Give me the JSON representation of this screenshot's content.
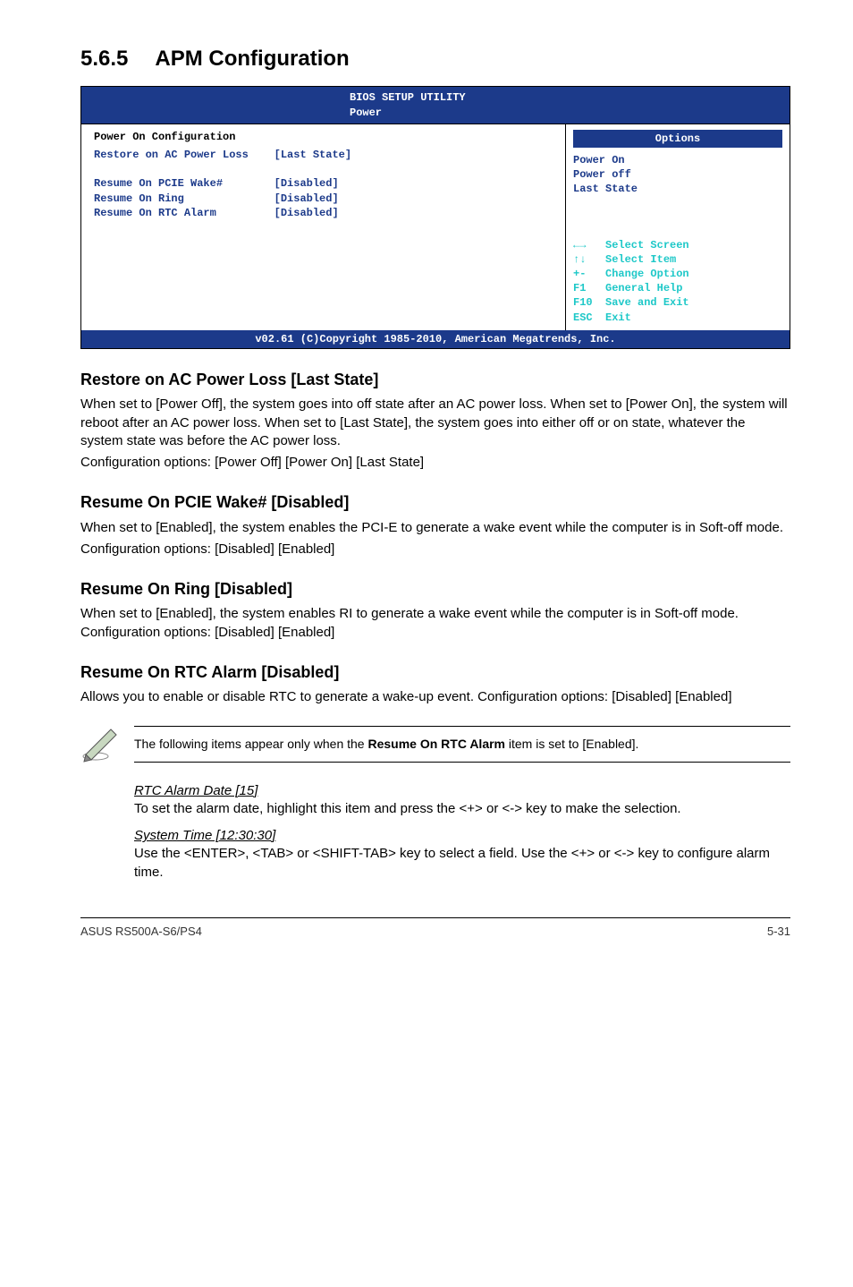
{
  "section": {
    "number": "5.6.5",
    "title": "APM Configuration"
  },
  "bios": {
    "header_line1": "BIOS SETUP UTILITY",
    "header_line2": "Power",
    "panel_title": "Power On Configuration",
    "items": [
      {
        "label": "Restore on AC Power Loss",
        "value": "[Last State]"
      },
      {
        "label": "",
        "value": ""
      },
      {
        "label": "Resume On PCIE Wake#",
        "value": "[Disabled]"
      },
      {
        "label": "Resume On Ring",
        "value": "[Disabled]"
      },
      {
        "label": "Resume On RTC Alarm",
        "value": "[Disabled]"
      }
    ],
    "right": {
      "header": "Options",
      "values": "Power On\nPower off\nLast State",
      "nav": "←→   Select Screen\n↑↓   Select Item\n+-   Change Option\nF1   General Help\nF10  Save and Exit\nESC  Exit"
    },
    "footer": "v02.61 (C)Copyright 1985-2010, American Megatrends, Inc."
  },
  "sections": {
    "s1": {
      "h": "Restore on AC Power Loss [Last State]",
      "p1": "When set to [Power Off], the system goes into off state after an AC power loss. When set to [Power On], the system will reboot after an AC power loss. When set to [Last State], the system goes into either off or on state, whatever the system state was before the AC power loss.",
      "p2": "Configuration options: [Power Off] [Power On] [Last State]"
    },
    "s2": {
      "h": "Resume On PCIE Wake# [Disabled]",
      "p1": "When set to [Enabled], the system enables the PCI-E to generate a wake event while the computer is in Soft-off mode.",
      "p2": "Configuration options: [Disabled] [Enabled]"
    },
    "s3": {
      "h": "Resume On Ring [Disabled]",
      "p1": "When set to [Enabled], the system enables RI to generate a wake event while the computer is in Soft-off mode. Configuration options: [Disabled] [Enabled]"
    },
    "s4": {
      "h": "Resume On RTC Alarm [Disabled]",
      "p1": "Allows you to enable or disable RTC to generate a wake-up event. Configuration options: [Disabled] [Enabled]"
    }
  },
  "note": {
    "text_prefix": "The following items appear only when the ",
    "bold": "Resume On RTC Alarm",
    "text_suffix": " item is set to [Enabled]."
  },
  "subitems": {
    "rtc": {
      "h": "RTC Alarm Date [15]",
      "p": "To set the alarm date, highlight this item and press the <+> or <-> key to make the selection."
    },
    "sys": {
      "h": "System Time [12:30:30]",
      "p": "Use the <ENTER>, <TAB> or <SHIFT-TAB> key to select a field. Use the <+> or <-> key to configure alarm time."
    }
  },
  "footer": {
    "left": "ASUS RS500A-S6/PS4",
    "right": "5-31"
  }
}
